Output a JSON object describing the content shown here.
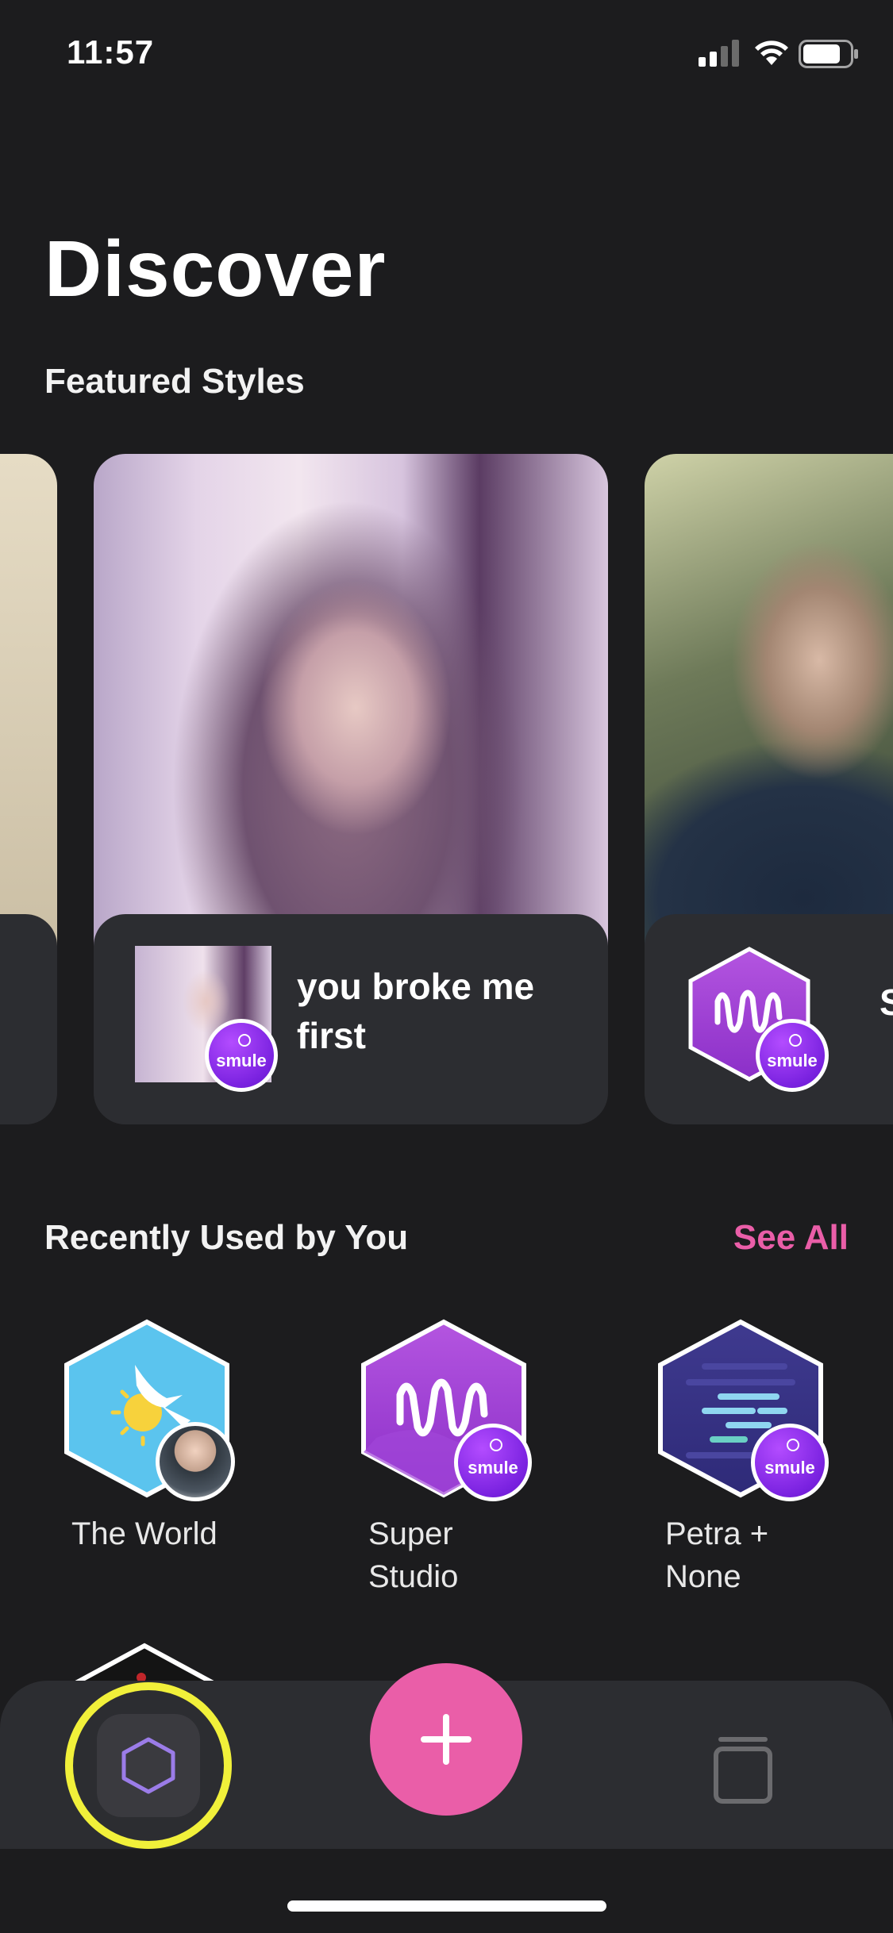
{
  "status_bar": {
    "time": "11:57"
  },
  "header": {
    "title": "Discover"
  },
  "featured": {
    "heading": "Featured Styles",
    "cards": [
      {
        "title": "you broke me first",
        "badge": "smule"
      },
      {
        "title": "Su",
        "badge": "smule"
      }
    ]
  },
  "recent": {
    "heading": "Recently Used by You",
    "see_all": "See All",
    "items": [
      {
        "label": "The World",
        "icon": "sun-bird-hexagon-icon"
      },
      {
        "label": "Super Studio",
        "icon": "waveform-hexagon-icon",
        "badge": "smule"
      },
      {
        "label": "Petra + None",
        "icon": "lines-hexagon-icon",
        "badge": "smule"
      }
    ]
  },
  "tabbar": {
    "items": [
      {
        "icon": "hexagon-icon",
        "active": true
      },
      {
        "icon": "plus-icon"
      },
      {
        "icon": "library-icon"
      }
    ]
  },
  "colors": {
    "background": "#1c1c1e",
    "accent_pink": "#ea5ea8",
    "purple": "#9b3fd6",
    "highlight_yellow": "#f1f03a"
  }
}
